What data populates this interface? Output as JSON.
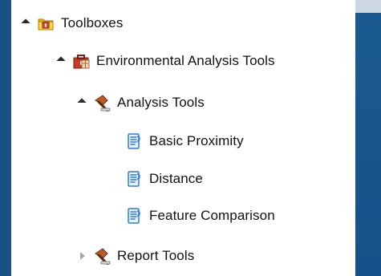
{
  "tree": {
    "items": [
      {
        "label": "Toolboxes",
        "expander": "expanded",
        "icon": "folder-icon"
      },
      {
        "label": "Environmental Analysis Tools",
        "expander": "expanded",
        "icon": "toolbox-icon"
      },
      {
        "label": "Analysis Tools",
        "expander": "expanded",
        "icon": "toolset-icon"
      },
      {
        "label": "Basic Proximity",
        "expander": "none",
        "icon": "script-tool-icon"
      },
      {
        "label": "Distance",
        "expander": "none",
        "icon": "script-tool-icon"
      },
      {
        "label": "Feature Comparison",
        "expander": "none",
        "icon": "script-tool-icon"
      },
      {
        "label": "Report Tools",
        "expander": "collapsed",
        "icon": "toolset-icon"
      }
    ]
  },
  "colors": {
    "background": "#1e5e93",
    "panel": "#ffffff",
    "text": "#111111",
    "script_icon": "#2f7bd6",
    "folder_icon": "#f2b400",
    "toolbox_icon": "#c93a2b"
  }
}
